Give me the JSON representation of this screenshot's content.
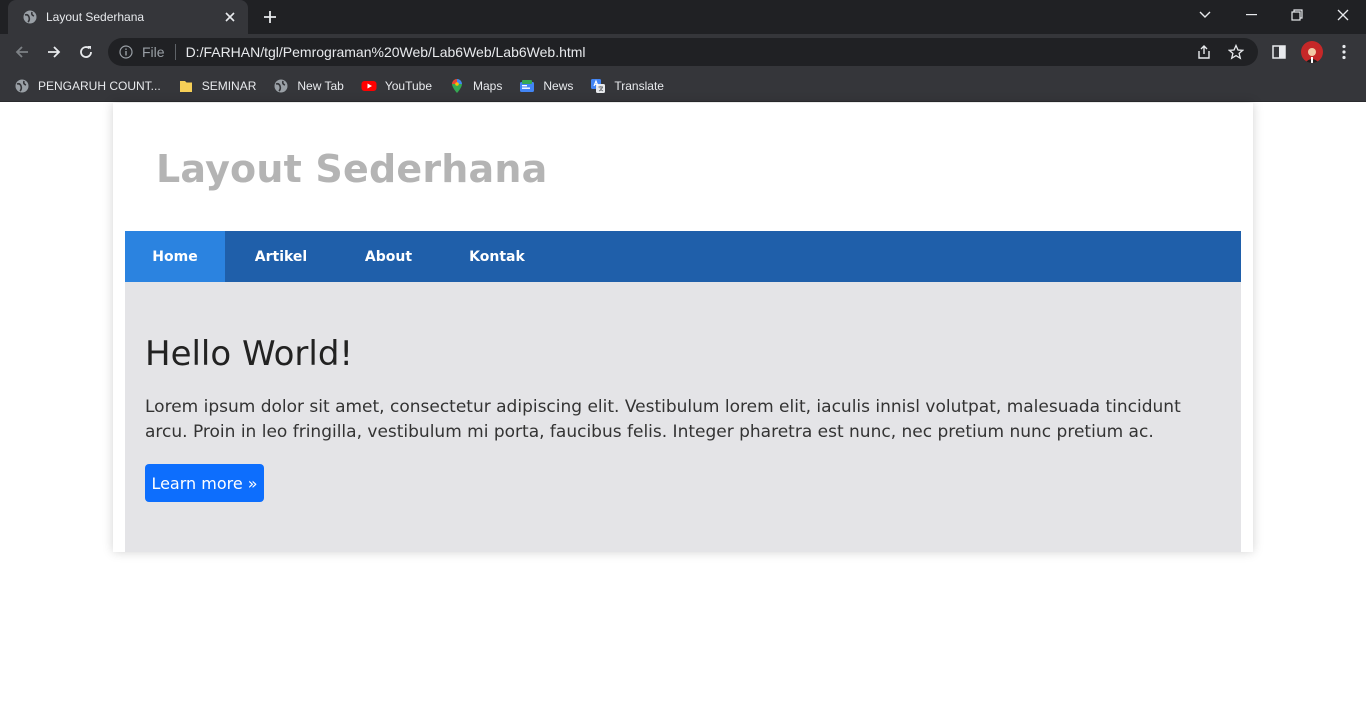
{
  "browser": {
    "tab": {
      "title": "Layout Sederhana",
      "favicon": "globe-icon"
    },
    "omnibox": {
      "scheme_label": "File",
      "url": "D:/FARHAN/tgl/Pemrograman%20Web/Lab6Web/Lab6Web.html"
    },
    "bookmarks": [
      {
        "label": "PENGARUH COUNT...",
        "icon": "globe-icon"
      },
      {
        "label": "SEMINAR",
        "icon": "folder-icon"
      },
      {
        "label": "New Tab",
        "icon": "globe-icon"
      },
      {
        "label": "YouTube",
        "icon": "youtube-icon"
      },
      {
        "label": "Maps",
        "icon": "maps-icon"
      },
      {
        "label": "News",
        "icon": "news-icon"
      },
      {
        "label": "Translate",
        "icon": "translate-icon"
      }
    ],
    "colors": {
      "frame": "#202124",
      "toolbar": "#35363a"
    }
  },
  "site": {
    "title": "Layout Sederhana",
    "nav": [
      {
        "label": "Home",
        "active": true
      },
      {
        "label": "Artikel",
        "active": false
      },
      {
        "label": "About",
        "active": false
      },
      {
        "label": "Kontak",
        "active": false
      }
    ],
    "hero": {
      "heading": "Hello World!",
      "text": "Lorem ipsum dolor sit amet, consectetur adipiscing elit. Vestibulum lorem elit, iaculis innisl volutpat, malesuada tincidunt arcu. Proin in leo fringilla, vestibulum mi porta, faucibus felis. Integer pharetra est nunc, nec pretium nunc pretium ac.",
      "button_label": "Learn more »"
    },
    "colors": {
      "nav": "#1f5faa",
      "nav_active": "#2b83e0",
      "hero_bg": "#e4e4e7",
      "button": "#0d6efd",
      "title": "#b4b4b4"
    }
  }
}
